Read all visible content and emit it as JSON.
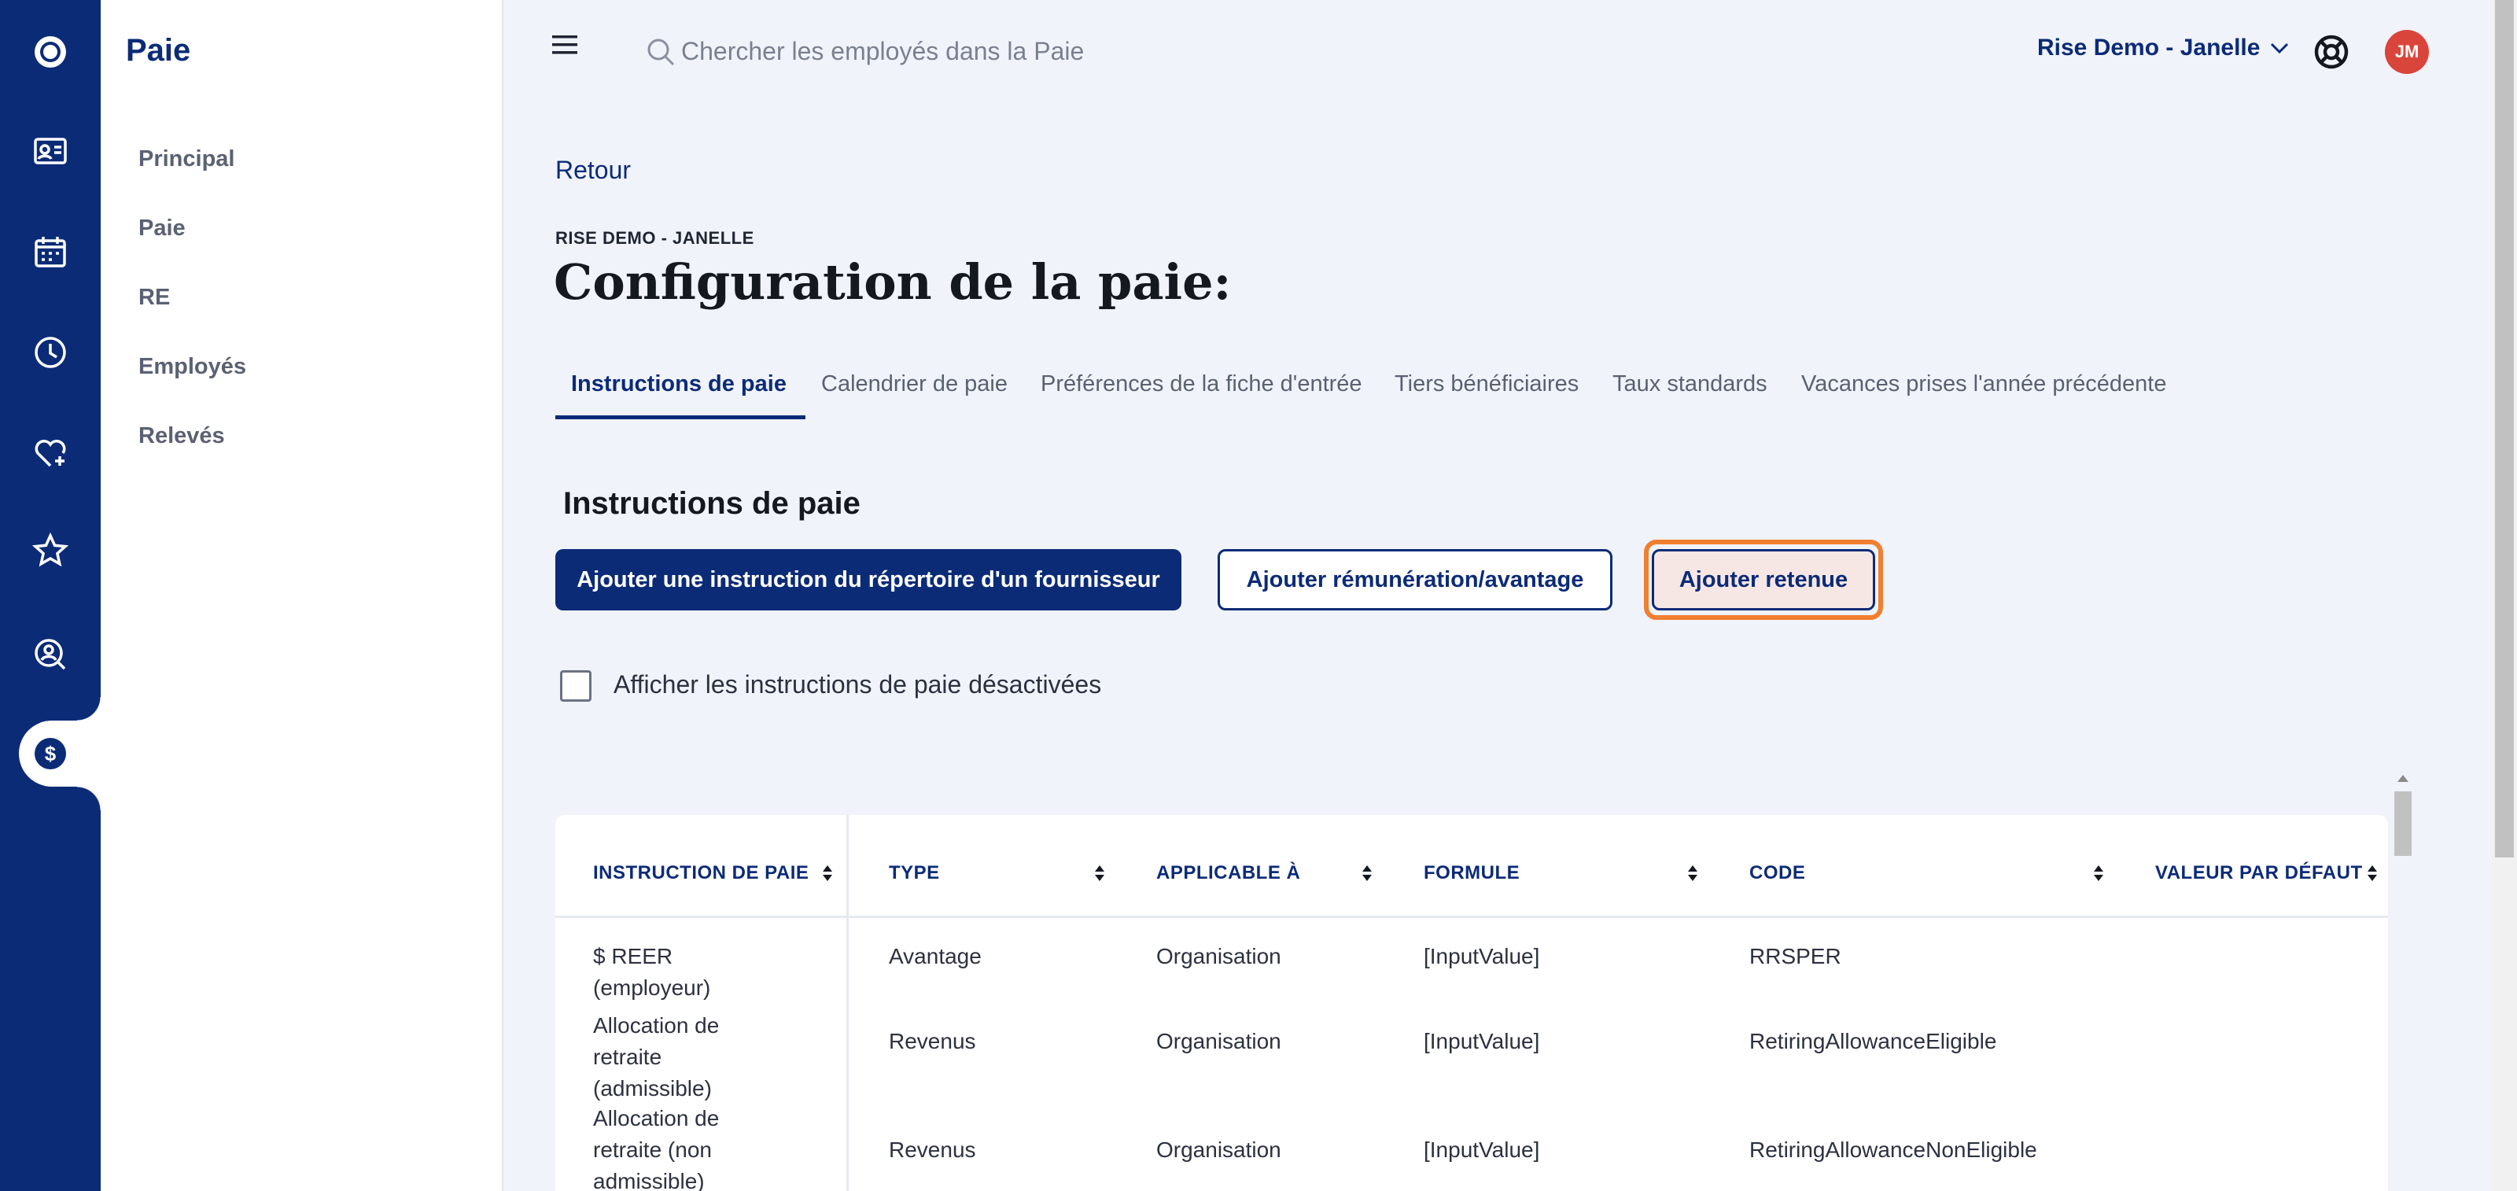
{
  "app": {
    "module_title": "Paie"
  },
  "rail": {
    "icons": [
      "logo-icon",
      "employee-card-icon",
      "calendar-icon",
      "clock-icon",
      "heart-plus-icon",
      "star-icon",
      "search-person-icon",
      "dollar-icon"
    ],
    "active_index": 7
  },
  "sidebar": {
    "items": [
      {
        "label": "Principal"
      },
      {
        "label": "Paie"
      },
      {
        "label": "RE"
      },
      {
        "label": "Employés"
      },
      {
        "label": "Relevés"
      }
    ]
  },
  "topbar": {
    "search_placeholder": "Chercher les employés dans la Paie",
    "org_name": "Rise Demo - Janelle",
    "avatar_initials": "JM"
  },
  "page": {
    "back_label": "Retour",
    "org_label": "RISE DEMO - JANELLE",
    "title": "Configuration de la paie:"
  },
  "tabs": [
    {
      "label": "Instructions de paie",
      "active": true
    },
    {
      "label": "Calendrier de paie",
      "active": false
    },
    {
      "label": "Préférences de la fiche d'entrée",
      "active": false
    },
    {
      "label": "Tiers bénéficiaires",
      "active": false
    },
    {
      "label": "Taux standards",
      "active": false
    },
    {
      "label": "Vacances prises l'année précédente",
      "active": false
    }
  ],
  "section": {
    "title": "Instructions de paie",
    "btn_vendor": "Ajouter une instruction du répertoire d'un fournisseur",
    "btn_earning": "Ajouter rémunération/avantage",
    "btn_deduction": "Ajouter retenue",
    "checkbox_label": "Afficher les instructions de paie désactivées"
  },
  "table": {
    "columns": [
      "INSTRUCTION DE PAIE",
      "TYPE",
      "APPLICABLE À",
      "FORMULE",
      "CODE",
      "VALEUR PAR DÉFAUT"
    ],
    "rows": [
      {
        "name": "$ REER (employeur)",
        "type": "Avantage",
        "applicable": "Organisation",
        "formula": "[InputValue]",
        "code": "RRSPER"
      },
      {
        "name": "Allocation de retraite (admissible)",
        "type": "Revenus",
        "applicable": "Organisation",
        "formula": "[InputValue]",
        "code": "RetiringAllowanceEligible"
      },
      {
        "name": "Allocation de retraite (non admissible)",
        "type": "Revenus",
        "applicable": "Organisation",
        "formula": "[InputValue]",
        "code": "RetiringAllowanceNonEligible"
      }
    ]
  },
  "colors": {
    "brand": "#0c2b77",
    "highlight": "#f07f2f",
    "avatar": "#d9453a"
  }
}
